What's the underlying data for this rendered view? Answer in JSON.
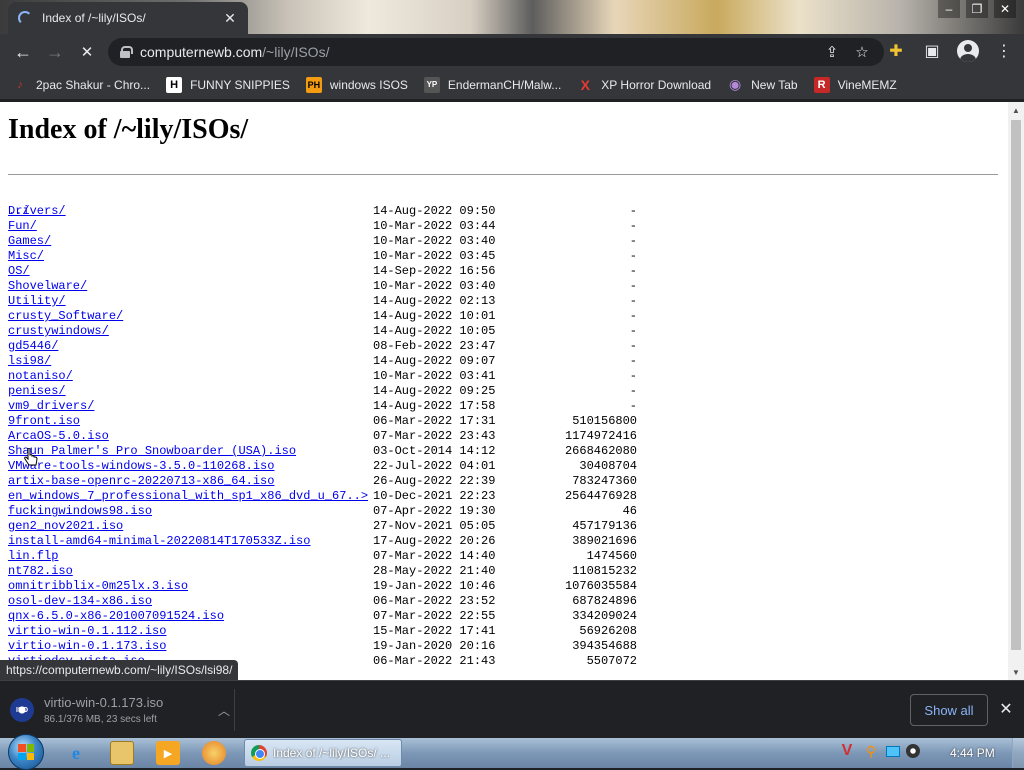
{
  "browser": {
    "tab": {
      "title": "Index of /~lily/ISOs/",
      "close_glyph": "✕"
    },
    "window_controls": [
      "–",
      "❐",
      "✕"
    ],
    "nav": {
      "back": "←",
      "forward": "→",
      "reload": "✕"
    },
    "omnibox": {
      "domain": "computernewb.com",
      "path": "/~lily/ISOs/"
    },
    "omni_icons": {
      "share": "⇪",
      "star": "☆"
    },
    "toolbar_icons": {
      "extensions": "✚",
      "side_panel": "▣",
      "menu": "⋮"
    },
    "bookmarks": [
      {
        "label": "2pac Shakur - Chro...",
        "icon": "♪",
        "color": "#c0392b"
      },
      {
        "label": "FUNNY SNIPPIES",
        "icon": "H",
        "color": "#ffffff"
      },
      {
        "label": "windows ISOS",
        "icon": "PH",
        "color": "#f39c12"
      },
      {
        "label": "EndermanCH/Malw...",
        "icon": "YP",
        "color": "#555555"
      },
      {
        "label": "XP Horror Download",
        "icon": "X",
        "color": "#e53935"
      },
      {
        "label": "New Tab",
        "icon": "◉",
        "color": "#8e44ad"
      },
      {
        "label": "VineMEMZ",
        "icon": "R",
        "color": "#c62828"
      }
    ]
  },
  "page": {
    "heading": "Index of /~lily/ISOs/",
    "parent_link": "../",
    "entries": [
      {
        "name": "Drivers/",
        "date": "14-Aug-2022 09:50",
        "size": "-"
      },
      {
        "name": "Fun/",
        "date": "10-Mar-2022 03:44",
        "size": "-"
      },
      {
        "name": "Games/",
        "date": "10-Mar-2022 03:40",
        "size": "-"
      },
      {
        "name": "Misc/",
        "date": "10-Mar-2022 03:45",
        "size": "-"
      },
      {
        "name": "OS/",
        "date": "14-Sep-2022 16:56",
        "size": "-"
      },
      {
        "name": "Shovelware/",
        "date": "10-Mar-2022 03:40",
        "size": "-"
      },
      {
        "name": "Utility/",
        "date": "14-Aug-2022 02:13",
        "size": "-"
      },
      {
        "name": "crusty_Software/",
        "date": "14-Aug-2022 10:01",
        "size": "-"
      },
      {
        "name": "crustywindows/",
        "date": "14-Aug-2022 10:05",
        "size": "-"
      },
      {
        "name": "gd5446/",
        "date": "08-Feb-2022 23:47",
        "size": "-"
      },
      {
        "name": "lsi98/",
        "date": "14-Aug-2022 09:07",
        "size": "-"
      },
      {
        "name": "notaniso/",
        "date": "10-Mar-2022 03:41",
        "size": "-"
      },
      {
        "name": "penises/",
        "date": "14-Aug-2022 09:25",
        "size": "-"
      },
      {
        "name": "vm9_drivers/",
        "date": "14-Aug-2022 17:58",
        "size": "-"
      },
      {
        "name": "9front.iso",
        "date": "06-Mar-2022 17:31",
        "size": "510156800"
      },
      {
        "name": "ArcaOS-5.0.iso",
        "date": "07-Mar-2022 23:43",
        "size": "1174972416"
      },
      {
        "name": "Shaun Palmer's Pro Snowboarder (USA).iso",
        "date": "03-Oct-2014 14:12",
        "size": "2668462080"
      },
      {
        "name": "VMware-tools-windows-3.5.0-110268.iso",
        "date": "22-Jul-2022 04:01",
        "size": "30408704"
      },
      {
        "name": "artix-base-openrc-20220713-x86_64.iso",
        "date": "26-Aug-2022 22:39",
        "size": "783247360"
      },
      {
        "name": "en_windows_7_professional_with_sp1_x86_dvd_u_67..>",
        "date": "10-Dec-2021 22:23",
        "size": "2564476928"
      },
      {
        "name": "fuckingwindows98.iso",
        "date": "07-Apr-2022 19:30",
        "size": "46"
      },
      {
        "name": "gen2_nov2021.iso",
        "date": "27-Nov-2021 05:05",
        "size": "457179136"
      },
      {
        "name": "install-amd64-minimal-20220814T170533Z.iso",
        "date": "17-Aug-2022 20:26",
        "size": "389021696"
      },
      {
        "name": "lin.flp",
        "date": "07-Mar-2022 14:40",
        "size": "1474560"
      },
      {
        "name": "nt782.iso",
        "date": "28-May-2022 21:40",
        "size": "110815232"
      },
      {
        "name": "omnitribblix-0m25lx.3.iso",
        "date": "19-Jan-2022 10:46",
        "size": "1076035584"
      },
      {
        "name": "osol-dev-134-x86.iso",
        "date": "06-Mar-2022 23:52",
        "size": "687824896"
      },
      {
        "name": "qnx-6.5.0-x86-201007091524.iso",
        "date": "07-Mar-2022 22:55",
        "size": "334209024"
      },
      {
        "name": "virtio-win-0.1.112.iso",
        "date": "15-Mar-2022 17:41",
        "size": "56926208"
      },
      {
        "name": "virtio-win-0.1.173.iso",
        "date": "19-Jan-2020 20:16",
        "size": "394354688"
      },
      {
        "name": "virtiodcv-vista.iso",
        "date": "06-Mar-2022 21:43",
        "size": "5507072"
      }
    ]
  },
  "status_bar": {
    "hover_url": "https://computernewb.com/~lily/ISOs/lsi98/"
  },
  "download_shelf": {
    "item": {
      "filename": "virtio-win-0.1.173.iso",
      "progress": "86.1/376 MB, 23 secs left",
      "icon_text": "ISO"
    },
    "show_all_label": "Show all",
    "close_glyph": "✕"
  },
  "taskbar": {
    "active_task_label": "Index of /~lily/ISOs/ ...",
    "clock": "4:44 PM",
    "pinned_icons": [
      "ie-icon",
      "explorer-icon",
      "media-player-icon",
      "paint-icon"
    ]
  },
  "colors": {
    "link": "#0000ee",
    "chrome_dark": "#35363a",
    "download_link": "#8ab4f8"
  }
}
